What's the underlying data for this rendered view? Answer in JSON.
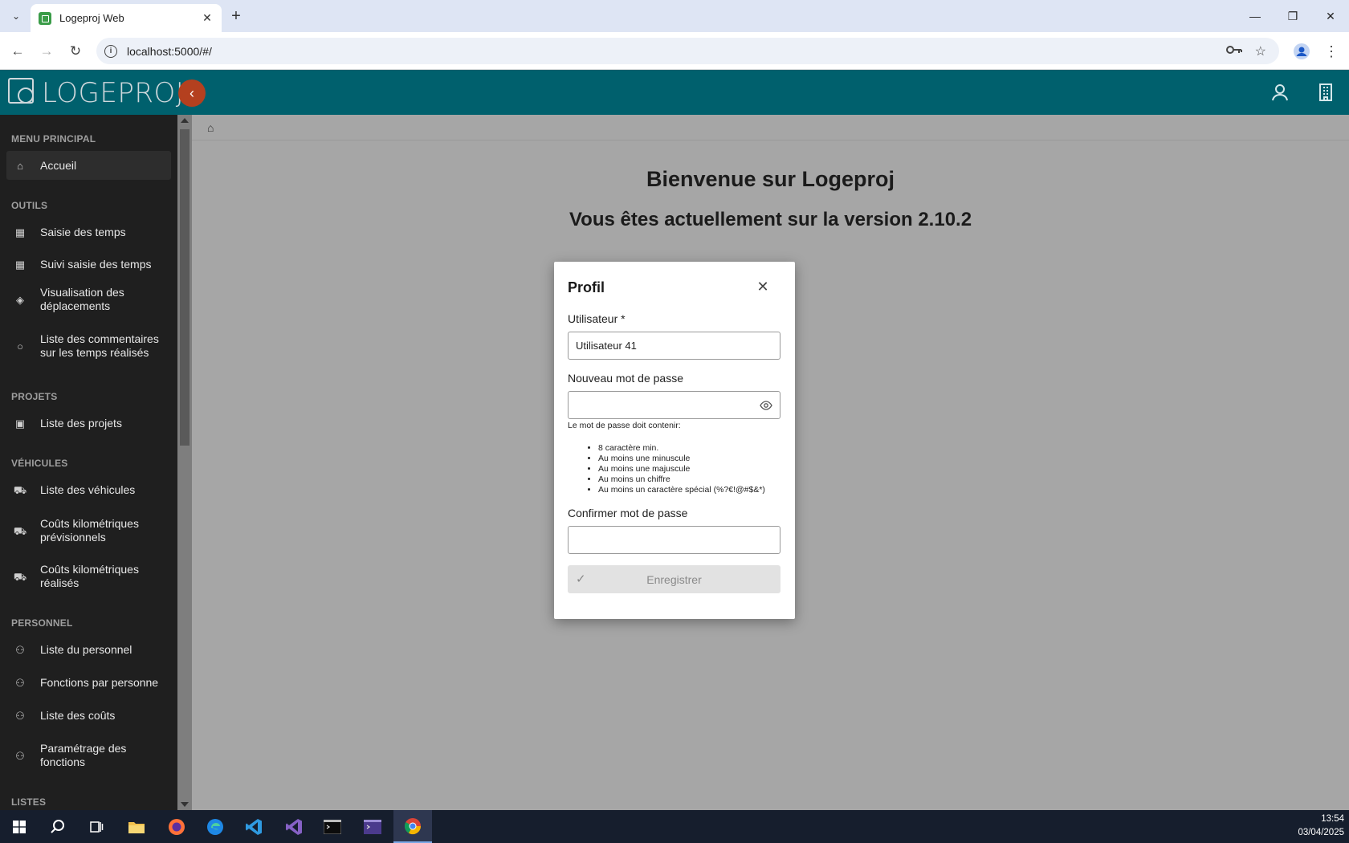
{
  "browser": {
    "tab_title": "Logeproj Web",
    "url": "localhost:5000/#/"
  },
  "app": {
    "logo_text": "LOGEPROJ",
    "accent": "#00606d",
    "collapse_color": "#b4401f"
  },
  "sidebar": {
    "sections": [
      {
        "title": "MENU PRINCIPAL"
      },
      {
        "title": "OUTILS"
      },
      {
        "title": "PROJETS"
      },
      {
        "title": "VÉHICULES"
      },
      {
        "title": "PERSONNEL"
      },
      {
        "title": "LISTES"
      }
    ],
    "items": [
      {
        "label": "Accueil",
        "icon": "home-icon"
      },
      {
        "label": "Saisie des temps",
        "icon": "calendar-icon"
      },
      {
        "label": "Suivi saisie des temps",
        "icon": "calendar-icon"
      },
      {
        "label": "Visualisation des déplacements",
        "icon": "direction-icon"
      },
      {
        "label": "Liste des commentaires sur les temps réalisés",
        "icon": "comment-icon"
      },
      {
        "label": "Liste des projets",
        "icon": "briefcase-icon"
      },
      {
        "label": "Liste des véhicules",
        "icon": "car-icon"
      },
      {
        "label": "Coûts kilométriques prévisionnels",
        "icon": "car-icon"
      },
      {
        "label": "Coûts kilométriques réalisés",
        "icon": "car-icon"
      },
      {
        "label": "Liste du personnel",
        "icon": "people-icon"
      },
      {
        "label": "Fonctions par personne",
        "icon": "people-icon"
      },
      {
        "label": "Liste des coûts",
        "icon": "people-icon"
      },
      {
        "label": "Paramétrage des fonctions",
        "icon": "people-icon"
      }
    ]
  },
  "main": {
    "welcome": "Bienvenue sur Logeproj",
    "version": "Vous êtes actuellement sur la version 2.10.2"
  },
  "dialog": {
    "title": "Profil",
    "user_label": "Utilisateur *",
    "user_value": "Utilisateur 41",
    "new_pw_label": "Nouveau mot de passe",
    "pw_hint": "Le mot de passe doit contenir:",
    "pw_rules": [
      "8 caractère min.",
      "Au moins une minuscule",
      "Au moins une majuscule",
      "Au moins un chiffre",
      "Au moins un caractère spécial (%?€!@#$&*)"
    ],
    "confirm_label": "Confirmer mot de passe",
    "save_label": "Enregistrer"
  },
  "taskbar": {
    "time": "13:54",
    "date": "03/04/2025"
  }
}
